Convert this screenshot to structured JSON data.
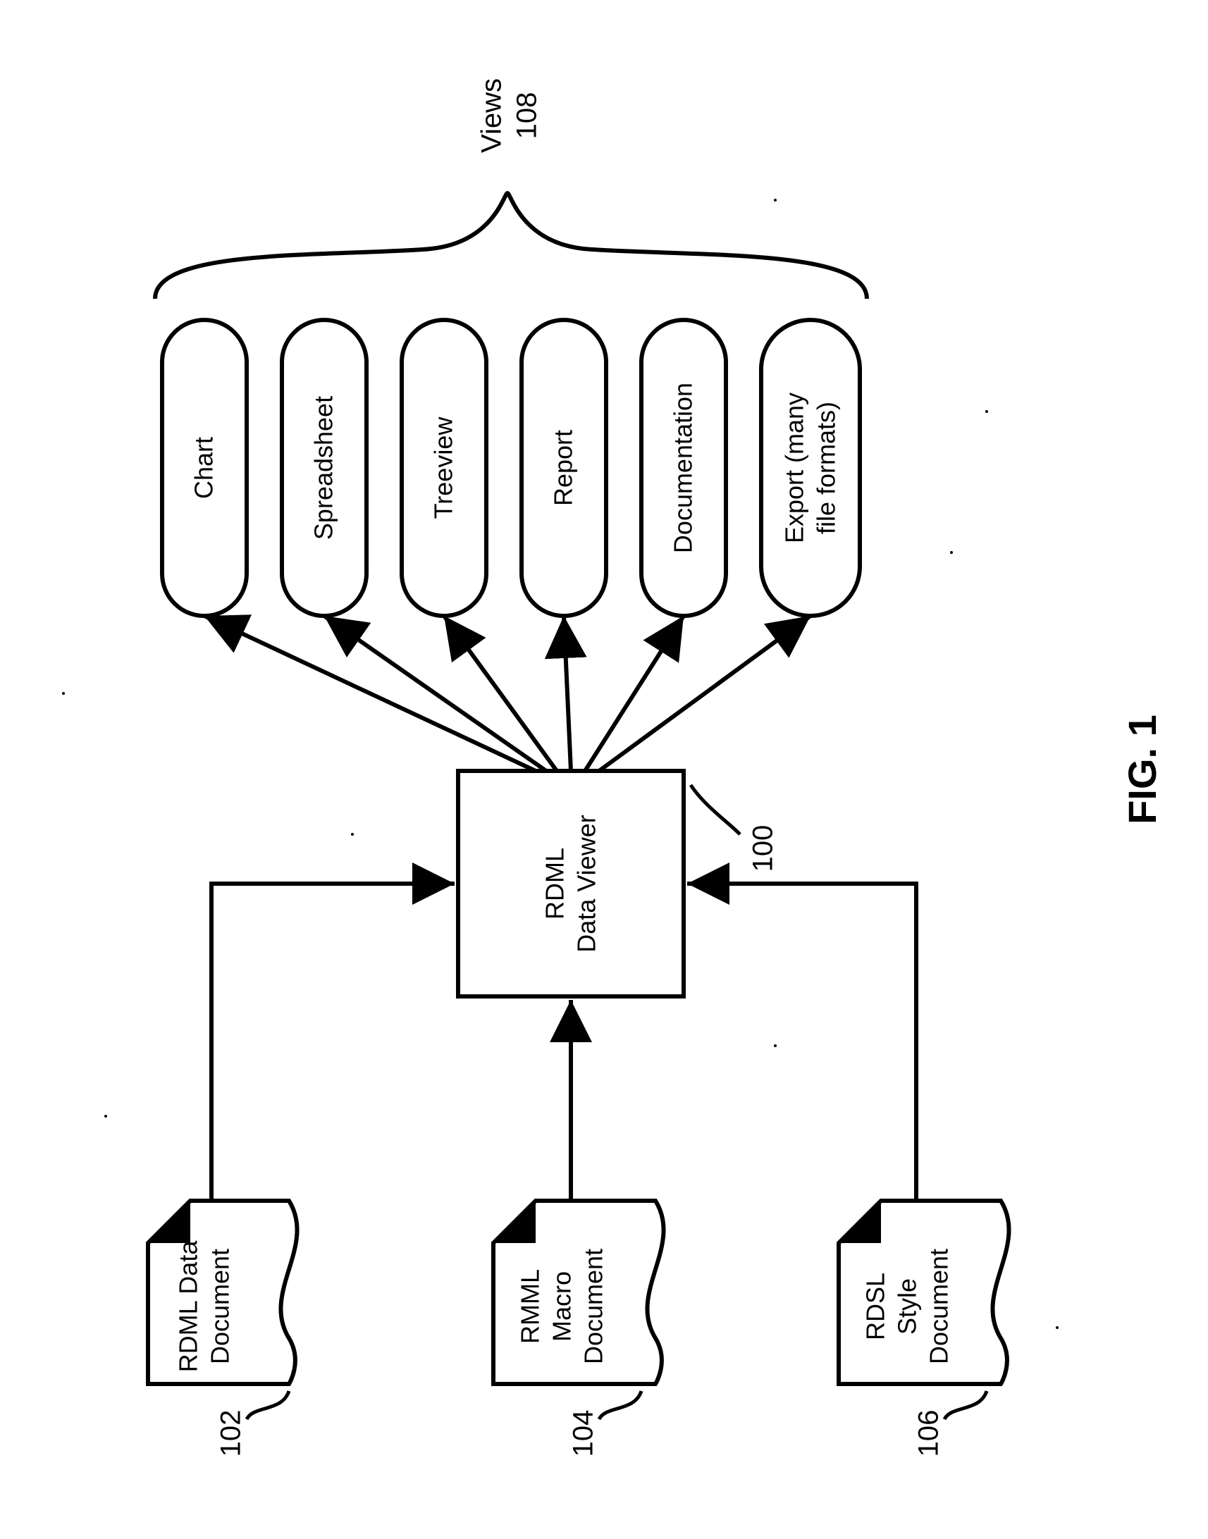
{
  "figure_label": "FIG. 1",
  "inputs": {
    "rdml_data": {
      "ref": "102",
      "line1": "RDML Data",
      "line2": "Document"
    },
    "rmml_macro": {
      "ref": "104",
      "line1": "RMML",
      "line2": "Macro",
      "line3": "Document"
    },
    "rdsl_style": {
      "ref": "106",
      "line1": "RDSL",
      "line2": "Style",
      "line3": "Document"
    }
  },
  "processor": {
    "ref": "100",
    "line1": "RDML",
    "line2": "Data Viewer"
  },
  "views_group": {
    "ref": "108",
    "label": "Views"
  },
  "views": [
    {
      "label": "Chart"
    },
    {
      "label": "Spreadsheet"
    },
    {
      "label": "Treeview"
    },
    {
      "label": "Report"
    },
    {
      "label": "Documentation"
    },
    {
      "label_line1": "Export (many",
      "label_line2": "file formats)"
    }
  ]
}
